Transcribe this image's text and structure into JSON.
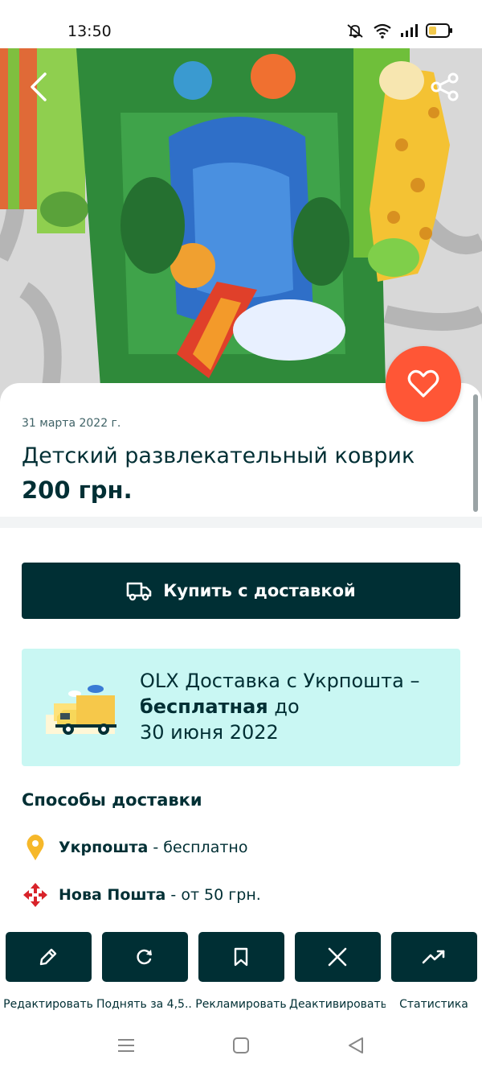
{
  "status_bar": {
    "time": "13:50"
  },
  "listing": {
    "date": "31 марта 2022 г.",
    "title": "Детский развлекательный коврик",
    "price": "200 грн."
  },
  "buy_button": {
    "label": "Купить с доставкой"
  },
  "promo": {
    "line1": "OLX Доставка с Укрпошта –",
    "bold": "бесплатная",
    "line2_rest": " до",
    "line3": "30 июня 2022"
  },
  "delivery": {
    "title": "Способы доставки",
    "methods": [
      {
        "name": "Укрпошта",
        "separator": " - ",
        "price": "бесплатно",
        "icon": "location-pin-icon"
      },
      {
        "name": "Нова Пошта",
        "separator": " - ",
        "price": "от 50 грн.",
        "icon": "nova-poshta-icon"
      }
    ]
  },
  "actions": [
    {
      "label": "Редактировать",
      "icon": "pencil-icon"
    },
    {
      "label": "Поднять за 4,5...",
      "icon": "refresh-icon"
    },
    {
      "label": "Рекламировать",
      "icon": "bookmark-icon"
    },
    {
      "label": "Деактивировать",
      "icon": "close-icon"
    },
    {
      "label": "Статистика",
      "icon": "trend-icon"
    }
  ],
  "colors": {
    "primary": "#002f34",
    "accent": "#ff5636",
    "promo_bg": "#c9f7f3"
  }
}
